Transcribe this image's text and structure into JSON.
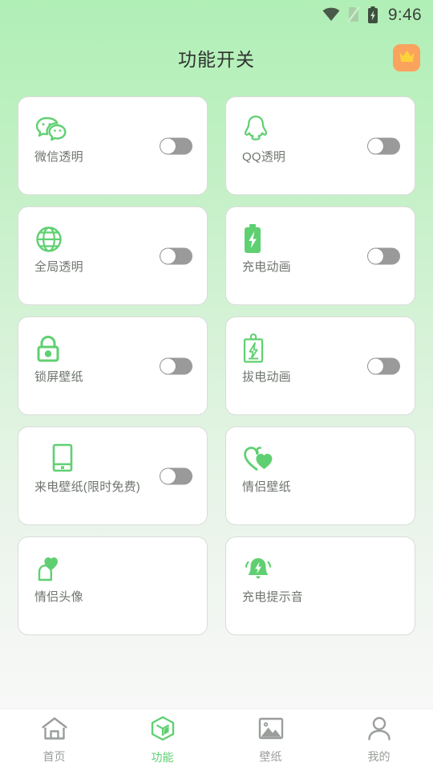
{
  "statusbar": {
    "time": "9:46",
    "icons": [
      "wifi-icon",
      "sim-card-icon",
      "battery-charging-icon"
    ]
  },
  "header": {
    "title": "功能开关",
    "vip_badge_icon": "crown-icon",
    "vip_badge_color": "#f9a35f",
    "crown_color": "#fcd23c"
  },
  "theme": {
    "accent": "#5fd071",
    "background_top": "#b0efb6",
    "background_bottom": "#fbfbfb",
    "card_background": "#ffffff",
    "label_color": "#6f756f",
    "toggle_off_track": "#9a9a9a",
    "toggle_knob": "#ffffff"
  },
  "features": [
    {
      "label": "微信透明",
      "icon": "wechat-icon",
      "has_toggle": true,
      "toggle_on": false
    },
    {
      "label": "QQ透明",
      "icon": "qq-penguin-icon",
      "has_toggle": true,
      "toggle_on": false
    },
    {
      "label": "全局透明",
      "icon": "globe-icon",
      "has_toggle": true,
      "toggle_on": false
    },
    {
      "label": "充电动画",
      "icon": "battery-charging-icon",
      "has_toggle": true,
      "toggle_on": false
    },
    {
      "label": "锁屏壁纸",
      "icon": "lock-icon",
      "has_toggle": true,
      "toggle_on": false
    },
    {
      "label": "拔电动画",
      "icon": "battery-unplug-icon",
      "has_toggle": true,
      "toggle_on": false
    },
    {
      "label": "来电壁纸(限时免费)",
      "icon": "phone-icon",
      "has_toggle": true,
      "toggle_on": false
    },
    {
      "label": "情侣壁纸",
      "icon": "double-heart-icon",
      "has_toggle": false,
      "toggle_on": false
    },
    {
      "label": "情侣头像",
      "icon": "heart-avatar-icon",
      "has_toggle": false,
      "toggle_on": false
    },
    {
      "label": "充电提示音",
      "icon": "bell-charging-icon",
      "has_toggle": false,
      "toggle_on": false
    }
  ],
  "bottom_nav": {
    "active_index": 1,
    "items": [
      {
        "label": "首页",
        "icon": "home-icon"
      },
      {
        "label": "功能",
        "icon": "cube-icon"
      },
      {
        "label": "壁纸",
        "icon": "image-icon"
      },
      {
        "label": "我的",
        "icon": "person-icon"
      }
    ]
  }
}
